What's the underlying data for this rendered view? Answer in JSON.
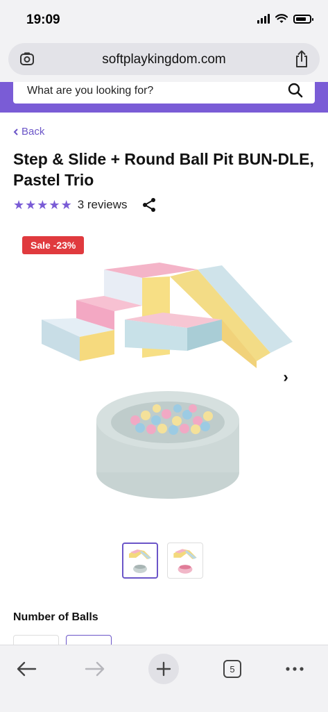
{
  "status_bar": {
    "time": "19:09"
  },
  "browser": {
    "url": "softplaykingdom.com",
    "tab_count": "5"
  },
  "header": {
    "search_placeholder": "What are you looking for?",
    "accent_color": "#7a5cd6"
  },
  "nav": {
    "back_label": "Back"
  },
  "product": {
    "title": "Step & Slide + Round Ball Pit BUN-DLE, Pastel Trio",
    "rating_stars": 5,
    "reviews_label": "3 reviews",
    "sale_badge": "Sale -23%",
    "thumbnail_count": 2,
    "selected_thumbnail": 1
  },
  "options": {
    "label": "Number of Balls"
  },
  "icons": {
    "search": "search-icon",
    "share": "share-icon",
    "next": "chevron-right-icon",
    "back": "chevron-left-icon",
    "tabs": "tabs-icon",
    "more": "more-icon"
  },
  "colors": {
    "sale": "#e03a3e",
    "stars": "#7a5cd6",
    "link": "#6b55c8"
  }
}
